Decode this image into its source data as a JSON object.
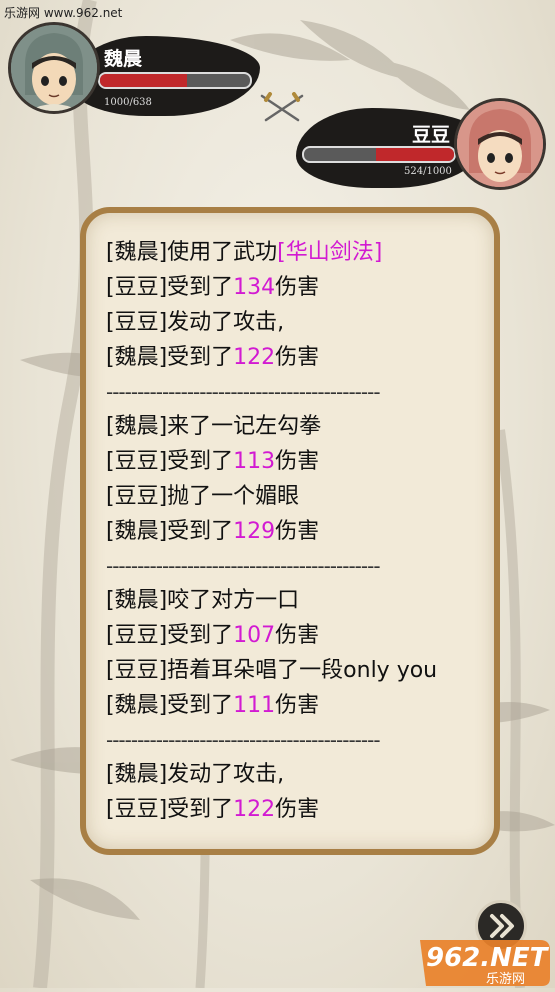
{
  "watermark": "乐游网 www.962.net",
  "player": {
    "name": "魏晨",
    "hp_text": "1000/638",
    "hp_fraction": 0.58
  },
  "enemy": {
    "name": "豆豆",
    "hp_text": "524/1000",
    "hp_fraction": 0.52
  },
  "battle_log": {
    "blocks": [
      [
        {
          "pre": "[魏晨]使用了武功",
          "hl": "[华山剑法]",
          "post": ""
        },
        {
          "pre": "[豆豆]受到了",
          "hl": "134",
          "post": "伤害"
        },
        {
          "pre": "[豆豆]发动了攻击,",
          "hl": "",
          "post": ""
        },
        {
          "pre": "[魏晨]受到了",
          "hl": "122",
          "post": "伤害"
        }
      ],
      [
        {
          "pre": "[魏晨]来了一记左勾拳",
          "hl": "",
          "post": ""
        },
        {
          "pre": "[豆豆]受到了",
          "hl": "113",
          "post": "伤害"
        },
        {
          "pre": "[豆豆]抛了一个媚眼",
          "hl": "",
          "post": ""
        },
        {
          "pre": "[魏晨]受到了",
          "hl": "129",
          "post": "伤害"
        }
      ],
      [
        {
          "pre": "[魏晨]咬了对方一口",
          "hl": "",
          "post": ""
        },
        {
          "pre": "[豆豆]受到了",
          "hl": "107",
          "post": "伤害"
        },
        {
          "pre": "[豆豆]捂着耳朵唱了一段only you",
          "hl": "",
          "post": ""
        },
        {
          "pre": "[魏晨]受到了",
          "hl": "111",
          "post": "伤害"
        }
      ],
      [
        {
          "pre": "[魏晨]发动了攻击,",
          "hl": "",
          "post": ""
        },
        {
          "pre": "[豆豆]受到了",
          "hl": "122",
          "post": "伤害"
        }
      ]
    ],
    "separator": "--------------------------------------------"
  },
  "logo": {
    "text": "962.NET",
    "subtext": "乐游网"
  },
  "colors": {
    "highlight": "#d21ad2",
    "hp_red": "#c0282b",
    "panel_border": "#a87f45"
  },
  "icons": {
    "skip": "fast-forward-icon",
    "swords": "crossed-swords-icon"
  }
}
